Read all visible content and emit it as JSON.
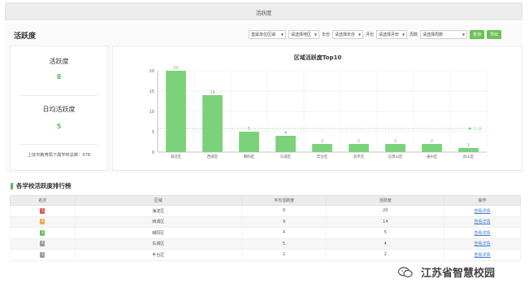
{
  "tabbar": {
    "tab_label": "活跃度"
  },
  "section": {
    "title": "活跃度"
  },
  "filters": {
    "district_select": "直属单位区域",
    "region_select": "请选择地区",
    "year_label": "年份",
    "year_select": "请选择年份",
    "month_label": "月份",
    "month_select": "请选择月份",
    "week_label": "周数",
    "week_select": "请选择周数",
    "query_button": "查询",
    "export_button": "导出"
  },
  "stats": {
    "activity_label": "活跃度",
    "activity_value": "8",
    "daily_label": "日均活跃度",
    "daily_value": "5",
    "footer": "上饶市教育局下属学校总数：478"
  },
  "chart_data": {
    "type": "bar",
    "title": "区域活跃度Top10",
    "categories": [
      "海淀区",
      "西城区",
      "朝阳区",
      "东城区",
      "丰台区",
      "昌平区",
      "石景山区",
      "通州区",
      "房山区"
    ],
    "values": [
      20,
      14,
      5,
      4,
      2,
      2,
      2,
      2,
      1
    ],
    "ylim": [
      0,
      20
    ],
    "yticks": [
      0,
      5,
      10,
      15,
      20
    ],
    "average_line": {
      "value": 5.78,
      "label": "5.78"
    },
    "bar_color": "#7bd27a",
    "xlabel": "",
    "ylabel": ""
  },
  "ranking": {
    "title": "各学校活跃度排行榜",
    "columns": [
      "名次",
      "区域",
      "平均活跃度",
      "活跃度",
      "操作"
    ],
    "rows": [
      {
        "rank": "1",
        "rank_color": "#e05a4a",
        "region": "海淀区",
        "avg": "9",
        "activity": "20",
        "action": "查看详情"
      },
      {
        "rank": "2",
        "rank_color": "#f0ad4e",
        "region": "西城区",
        "avg": "9",
        "activity": "14",
        "action": "查看详情"
      },
      {
        "rank": "3",
        "rank_color": "#6cc257",
        "region": "朝阳区",
        "avg": "4",
        "activity": "5",
        "action": "查看详情"
      },
      {
        "rank": "4",
        "rank_color": "#9a9a9a",
        "region": "东城区",
        "avg": "5",
        "activity": "4",
        "action": "查看详情"
      },
      {
        "rank": "5",
        "rank_color": "#9a9a9a",
        "region": "丰台区",
        "avg": "2",
        "activity": "2",
        "action": "查看详情"
      }
    ]
  },
  "watermark": {
    "text": "江苏省智慧校园",
    "icon": "wechat-icon"
  }
}
